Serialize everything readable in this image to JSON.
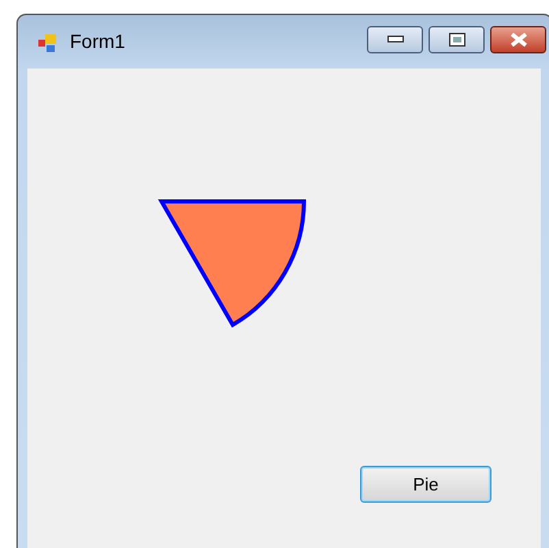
{
  "window": {
    "title": "Form1"
  },
  "canvas": {
    "shape": {
      "kind": "pie"
    }
  },
  "button": {
    "label": "Pie",
    "focused": true
  }
}
